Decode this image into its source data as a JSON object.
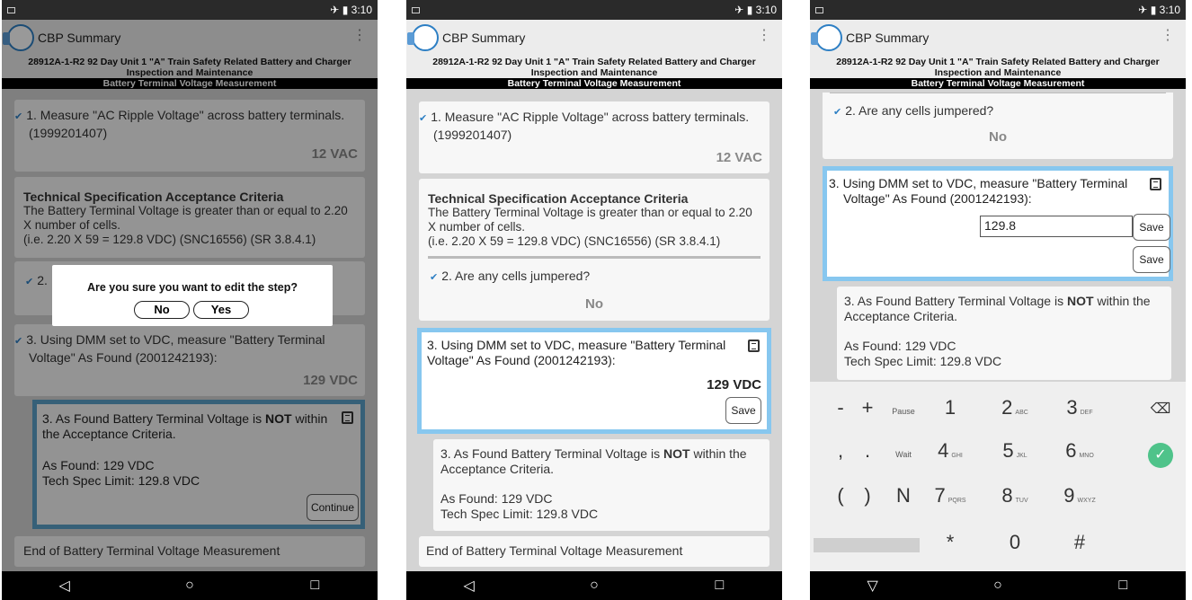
{
  "status": {
    "time": "3:10",
    "plane": "✈",
    "batt": "▮"
  },
  "app": {
    "title": "CBP Summary",
    "menu": "⋮"
  },
  "procedure_title": "28912A-1-R2 92 Day Unit 1 \"A\" Train Safety Related Battery and Charger Inspection and Maintenance",
  "section_title": "Battery Terminal Voltage Measurement",
  "step1": {
    "text": "1. Measure \"AC Ripple Voltage\" across battery terminals. (1999201407)",
    "value": "12 VAC"
  },
  "criteria": {
    "title": "Technical Specification Acceptance Criteria",
    "text": "The Battery Terminal Voltage is greater than or equal to 2.20 X number of cells.",
    "note": "(i.e. 2.20 X 59 = 129.8 VDC) (SNC16556) (SR 3.8.4.1)"
  },
  "step2": {
    "text": "2. Are any cells jumpered?",
    "short": "2.",
    "answer": "No"
  },
  "step3": {
    "text": "3. Using DMM set to VDC, measure \"Battery Terminal Voltage\" As Found (2001242193):",
    "value": "129 VDC",
    "input_value": "129.8"
  },
  "step3b": {
    "pre": "3. As Found Battery Terminal Voltage is",
    "strong": "NOT",
    "post_screen1": "within the Acceptance Criteria.",
    "post": "within the Acceptance Criteria.",
    "as_found": "As Found: 129 VDC",
    "limit": "Tech Spec Limit: 129.8 VDC"
  },
  "end_label": "End of Battery Terminal Voltage Measurement",
  "buttons": {
    "save": "Save",
    "continue": "Continue",
    "no": "No",
    "yes": "Yes"
  },
  "dialog": {
    "question": "Are you sure you want to edit the step?"
  },
  "keys": {
    "r1": [
      "-",
      "+",
      "Pause",
      "1",
      "2",
      "3"
    ],
    "r1s": [
      "",
      "",
      "",
      "",
      "ABC",
      "DEF"
    ],
    "r2": [
      ",",
      ".",
      "Wait",
      "4",
      "5",
      "6"
    ],
    "r2s": [
      "",
      "",
      "",
      "GHI",
      "JKL",
      "MNO"
    ],
    "r3": [
      "(",
      ")",
      "N",
      "7",
      "8",
      "9"
    ],
    "r3s": [
      "",
      "",
      "",
      "PQRS",
      "TUV",
      "WXYZ"
    ],
    "r4": [
      "*",
      "0",
      "#"
    ]
  }
}
